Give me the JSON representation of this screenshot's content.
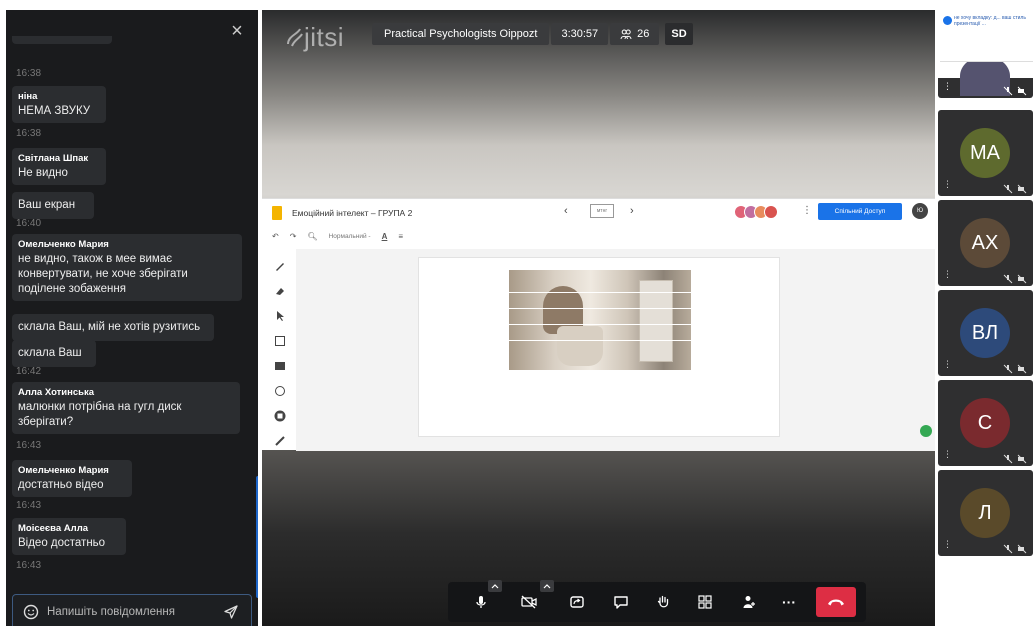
{
  "chat": {
    "close_label": "×",
    "messages": [
      {
        "sender": "",
        "text": "",
        "time": "16:38"
      },
      {
        "sender": "ніна",
        "text": "НЕМА ЗВУКУ",
        "time": "16:38"
      },
      {
        "sender": "Світлана Шпак",
        "text": "Не видно",
        "time": ""
      },
      {
        "sender": "",
        "text": "Ваш екран",
        "time": "16:40"
      },
      {
        "sender": "Омельченко Мария",
        "text": "не видно, також  в мее вимає конвертувати, не хоче зберігати поділене зобаження",
        "time": ""
      },
      {
        "sender": "",
        "text": "склала Ваш, мій не хотів рузитись",
        "time": ""
      },
      {
        "sender": "",
        "text": "склала Ваш",
        "time": "16:42"
      },
      {
        "sender": "Алла Хотинська",
        "text": "малюнки потрібна на гугл диск зберігати?",
        "time": "16:43"
      },
      {
        "sender": "Омельченко Мария",
        "text": "достатньо відео",
        "time": "16:43"
      },
      {
        "sender": "Моісеєва Алла",
        "text": "Відео достатньо",
        "time": "16:43"
      }
    ],
    "composer_placeholder": "Напишіть повідомлення"
  },
  "conference": {
    "logo": "jitsi",
    "room_name": "Practical Psychologists Oippozt",
    "duration": "3:30:57",
    "participants_count": "26",
    "quality_badge": "SD"
  },
  "shared_app": {
    "doc_title": "Емоційний інтелект – ГРУПА 2",
    "prev": "‹",
    "next": "›",
    "thumb_label": "мтнг",
    "share_button": "Спільний Доступ",
    "user_initials": "Ю",
    "format_label": "Нормальний -",
    "text_tool": "A",
    "colors": {
      "share_button": "#1a73e8",
      "doc_icon": "#f4b400"
    }
  },
  "filmstrip": {
    "first_tile_text": "не хочу вкладку: д... ваш стиль презентації ...",
    "participants": [
      {
        "initials": "МА",
        "color": "#5e6a2e"
      },
      {
        "initials": "АХ",
        "color": "#5c4a38"
      },
      {
        "initials": "ВЛ",
        "color": "#2d4a7a"
      },
      {
        "initials": "С",
        "color": "#7a2a2e"
      },
      {
        "initials": "Л",
        "color": "#5a4a2a"
      }
    ]
  },
  "toolbar": {
    "more_label": "···",
    "hangup_color": "#dd2e44"
  }
}
